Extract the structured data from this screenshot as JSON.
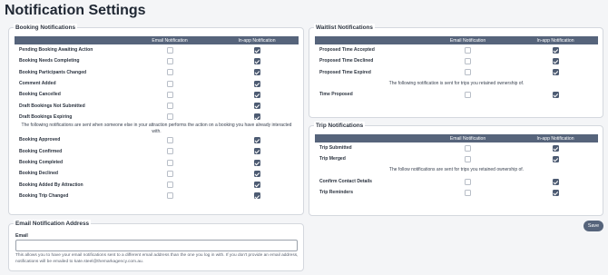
{
  "page_title": "Notification Settings",
  "booking": {
    "legend": "Booking Notifications",
    "headers": [
      "",
      "Email Notification",
      "In-app Notification"
    ],
    "rows_a": [
      {
        "label": "Pending Booking Awaiting Action",
        "email": false,
        "inapp": true
      },
      {
        "label": "Booking Needs Completing",
        "email": false,
        "inapp": true
      },
      {
        "label": "Booking Participants Changed",
        "email": false,
        "inapp": true
      },
      {
        "label": "Comment Added",
        "email": false,
        "inapp": true
      },
      {
        "label": "Booking Cancelled",
        "email": false,
        "inapp": true
      },
      {
        "label": "Draft Bookings Not Submitted",
        "email": false,
        "inapp": true
      },
      {
        "label": "Draft Bookings Expiring",
        "email": false,
        "inapp": true
      }
    ],
    "note": "The following notifications are sent when someone else in your attraction performs the action on a booking you have already interacted with.",
    "rows_b": [
      {
        "label": "Booking Approved",
        "email": false,
        "inapp": true
      },
      {
        "label": "Booking Confirmed",
        "email": false,
        "inapp": true
      },
      {
        "label": "Booking Completed",
        "email": false,
        "inapp": true
      },
      {
        "label": "Booking Declined",
        "email": false,
        "inapp": true
      },
      {
        "label": "Booking Added By Attraction",
        "email": false,
        "inapp": true
      },
      {
        "label": "Booking Trip Changed",
        "email": false,
        "inapp": true
      }
    ]
  },
  "waitlist": {
    "legend": "Waitlist Notifications",
    "headers": [
      "",
      "Email Notification",
      "In-app Notification"
    ],
    "rows_a": [
      {
        "label": "Proposed Time Accepted",
        "email": false,
        "inapp": true
      },
      {
        "label": "Proposed Time Declined",
        "email": false,
        "inapp": true
      },
      {
        "label": "Proposed Time Expired",
        "email": false,
        "inapp": true
      }
    ],
    "note": "The following notification is sent for trips you retained ownership of.",
    "rows_b": [
      {
        "label": "Time Proposed",
        "email": false,
        "inapp": true
      }
    ]
  },
  "trip": {
    "legend": "Trip Notifications",
    "headers": [
      "",
      "Email Notification",
      "In-app Notification"
    ],
    "rows_a": [
      {
        "label": "Trip Submitted",
        "email": false,
        "inapp": true
      },
      {
        "label": "Trip Merged",
        "email": false,
        "inapp": true
      }
    ],
    "note": "The follow notifications are sent for trips you retained ownership of.",
    "rows_b": [
      {
        "label": "Confirm Contact Details",
        "email": false,
        "inapp": true
      },
      {
        "label": "Trip Reminders",
        "email": false,
        "inapp": true
      }
    ]
  },
  "email_address": {
    "legend": "Email Notification Address",
    "label": "Email",
    "value": "",
    "help": "This allows you to have your email notifications sent to a different email address than the one you log in with. If you don't provide an email address, notifications will be emailed to kate.steel@themarkagency.com.au."
  },
  "save_label": "Save",
  "colors": {
    "header": "#56647b",
    "checked": "#4d5b72",
    "background": "#f4f5f7"
  }
}
